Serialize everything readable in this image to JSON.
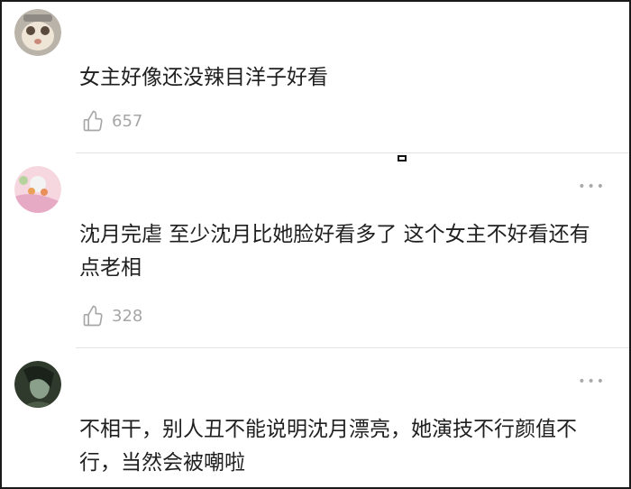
{
  "comments": [
    {
      "text": "女主好像还没辣目洋子好看",
      "likes": "657",
      "avatar_icon": "cartoon-face-avatar-icon"
    },
    {
      "text": "沈月完虐 至少沈月比她脸好看多了 这个女主不好看还有点老相",
      "likes": "328",
      "avatar_icon": "pink-flower-avatar-icon",
      "more_label": "•••"
    },
    {
      "text": "不相干，别人丑不能说明沈月漂亮，她演技不行颜值不行，当然会被嘲啦",
      "avatar_icon": "dark-portrait-avatar-icon",
      "more_label": "•••"
    }
  ],
  "colors": {
    "text": "#1f1f1f",
    "meta": "#a6a6a6",
    "divider": "#e3e3e3",
    "frame": "#1a1a1a"
  }
}
